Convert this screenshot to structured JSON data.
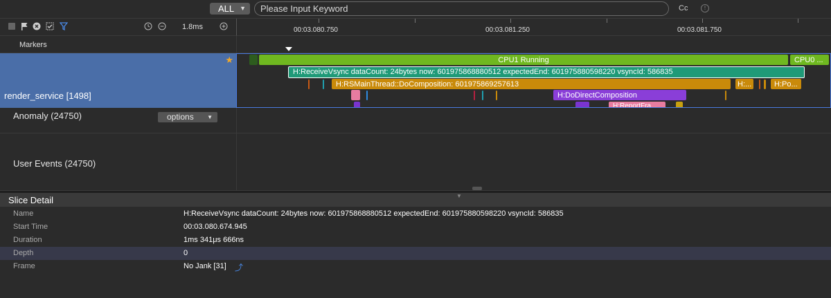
{
  "top_bar": {
    "filter_label": "ALL",
    "search_placeholder": "Please Input Keyword",
    "cc_label": "Cc"
  },
  "toolbar": {
    "zoom_level": "1.8ms"
  },
  "ruler": {
    "ticks": [
      "00:03.080.750",
      "00:03.081.250",
      "00:03.081.750"
    ]
  },
  "markers": {
    "label": "Markers"
  },
  "process_track": {
    "name": "render_service [1498]",
    "slices": {
      "cpu1": "CPU1 Running",
      "cpu0": "CPU0 ...",
      "receive_vsync": "H:ReceiveVsync dataCount: 24bytes now: 601975868880512 expectedEnd: 601975880598220 vsyncId: 586835",
      "rs_main": "H:RSMainThread::DoComposition: 601975869257613",
      "h_short_1": "H:...",
      "h_short_2": "H:Po...",
      "direct_comp": "H:DoDirectComposition",
      "report_frame": "H:ReportFra..."
    }
  },
  "rows": {
    "anomaly": "Anomaly (24750)",
    "options": "options",
    "user_events": "User Events (24750)"
  },
  "colors": {
    "selected_track": "#4a6ea8",
    "cpu_running": "#6fb820",
    "vsync_slice": "#1f9a78",
    "main_thread_slice": "#c98a0a",
    "purple_slice": "#8a3ed8",
    "pink_slice": "#e87ca0"
  },
  "slice_detail": {
    "title": "Slice Detail",
    "rows": [
      {
        "key": "Name",
        "value": "H:ReceiveVsync dataCount: 24bytes now: 601975868880512 expectedEnd: 601975880598220 vsyncId: 586835"
      },
      {
        "key": "Start Time",
        "value": "00:03.080.674.945"
      },
      {
        "key": "Duration",
        "value": "1ms 341μs 666ns"
      },
      {
        "key": "Depth",
        "value": "0"
      },
      {
        "key": "Frame",
        "value": "No Jank [31]"
      }
    ]
  }
}
